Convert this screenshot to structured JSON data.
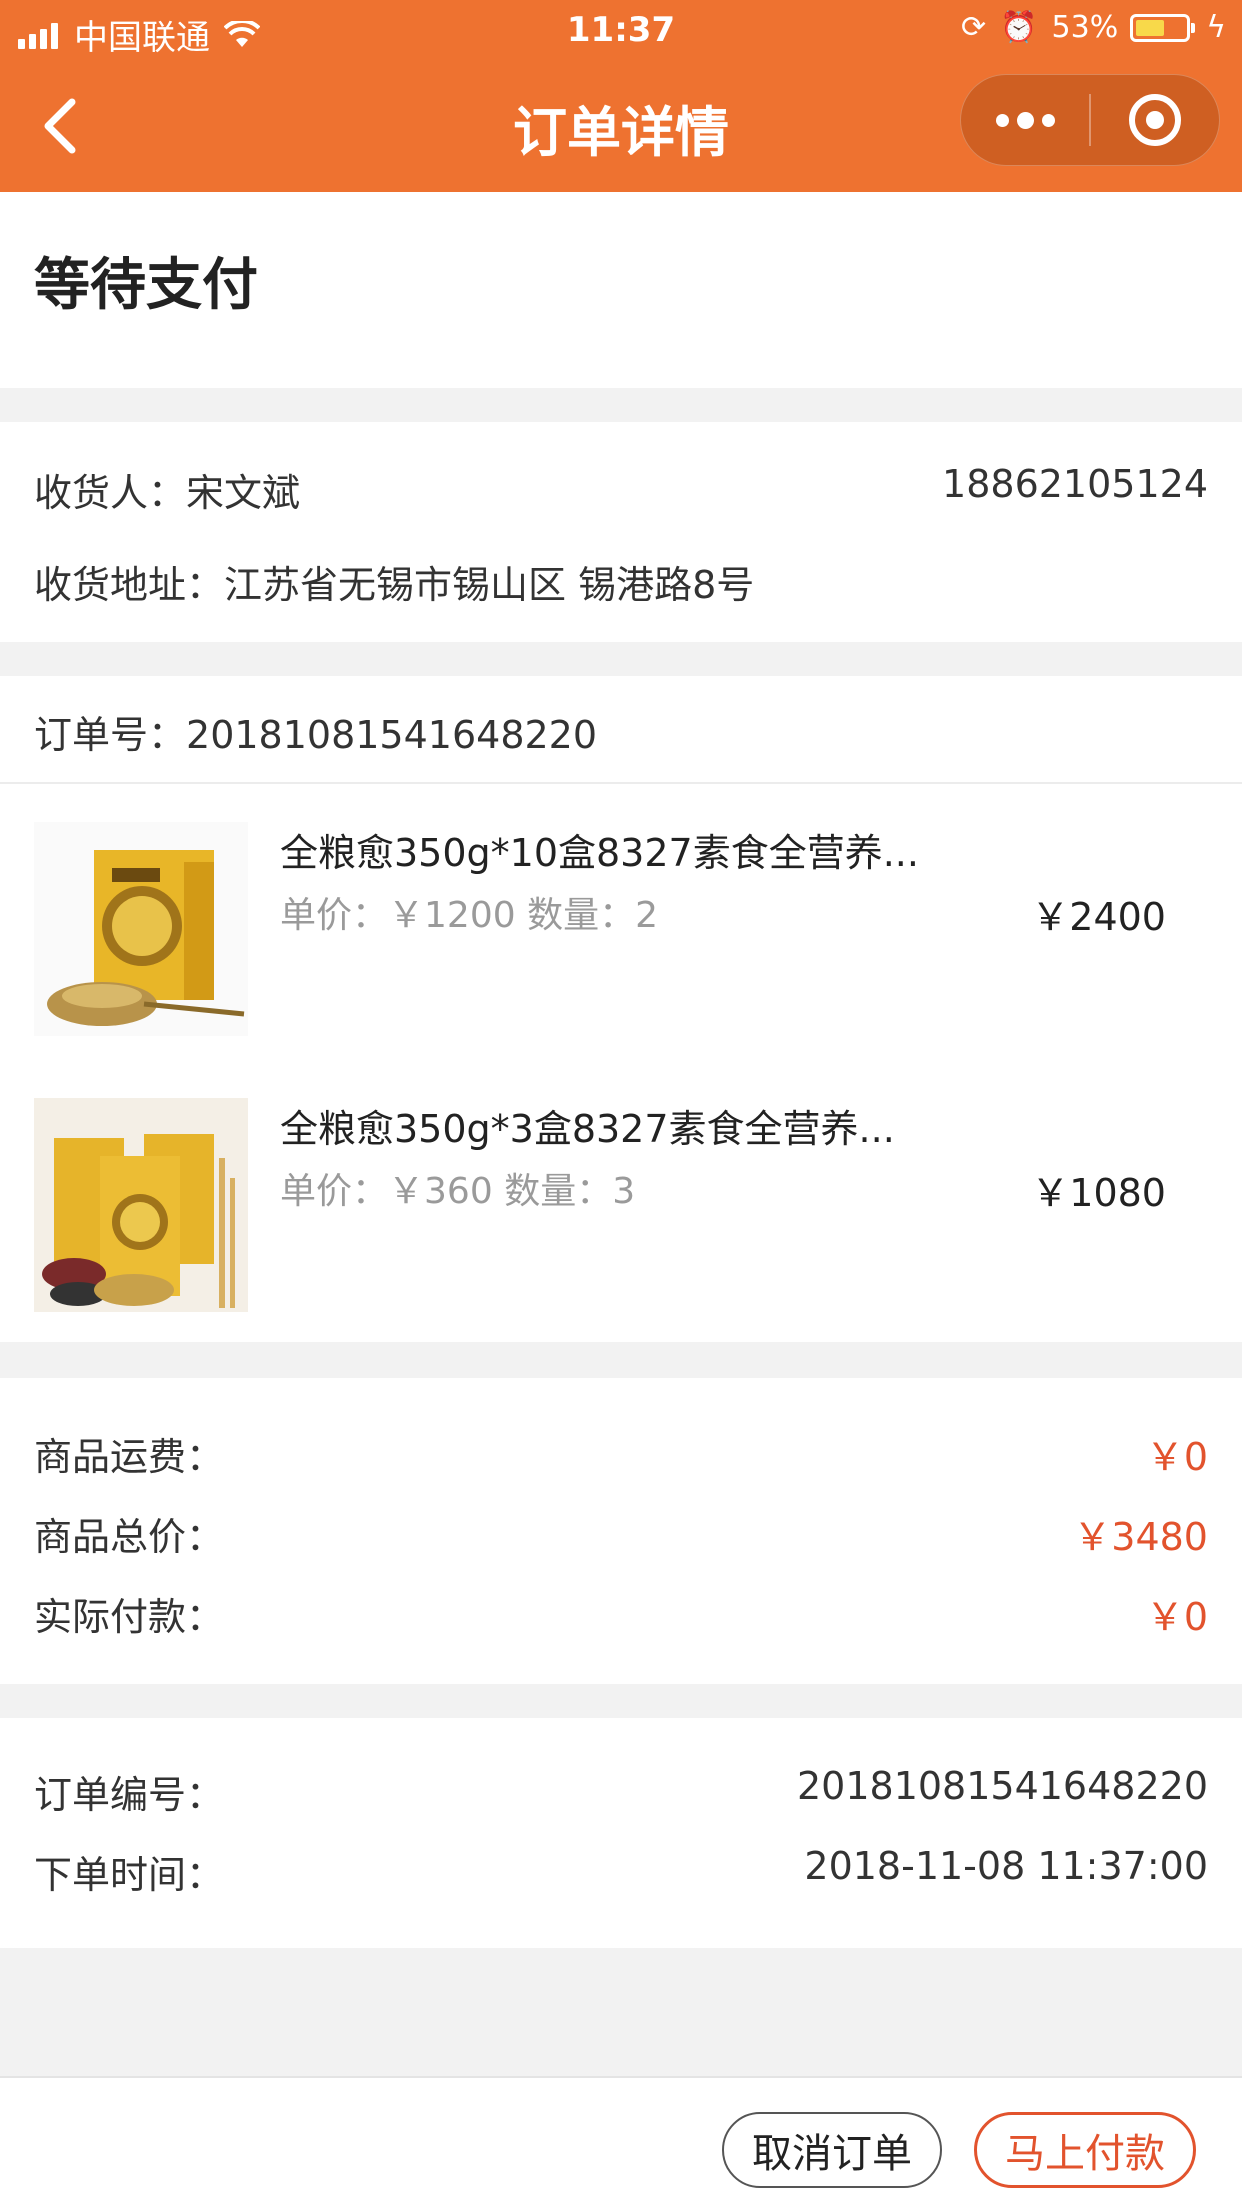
{
  "status_bar": {
    "carrier": "中国联通",
    "time": "11:37",
    "battery": "53%"
  },
  "nav": {
    "title": "订单详情",
    "back_icon": "chevron-left-icon",
    "more_icon": "more-dots-icon",
    "close_icon": "target-circle-icon"
  },
  "order_status": "等待支付",
  "receiver": {
    "name_label": "收货人：",
    "name": "宋文斌",
    "phone": "18862105124",
    "address_label": "收货地址：",
    "address": "江苏省无锡市锡山区 锡港路8号"
  },
  "order_no_line": {
    "label": "订单号：",
    "value": "20181081541648220"
  },
  "products": [
    {
      "title": "全粮愈350g*10盒8327素食全营养...",
      "unit_price_label": "单价：",
      "unit_price": "￥1200",
      "qty_label": "数量：",
      "qty": "2",
      "total": "￥2400"
    },
    {
      "title": "全粮愈350g*3盒8327素食全营养...",
      "unit_price_label": "单价：",
      "unit_price": "￥360",
      "qty_label": "数量：",
      "qty": "3",
      "total": "￥1080"
    }
  ],
  "summary": {
    "shipping_label": "商品运费：",
    "shipping": "￥0",
    "total_label": "商品总价：",
    "total": "￥3480",
    "paid_label": "实际付款：",
    "paid": "￥0"
  },
  "order_info": {
    "number_label": "订单编号：",
    "number": "20181081541648220",
    "time_label": "下单时间：",
    "time": "2018-11-08 11:37:00"
  },
  "footer": {
    "cancel_label": "取消订单",
    "pay_label": "马上付款"
  },
  "colors": {
    "brand": "#ee7230",
    "accent_red": "#e2532d"
  }
}
